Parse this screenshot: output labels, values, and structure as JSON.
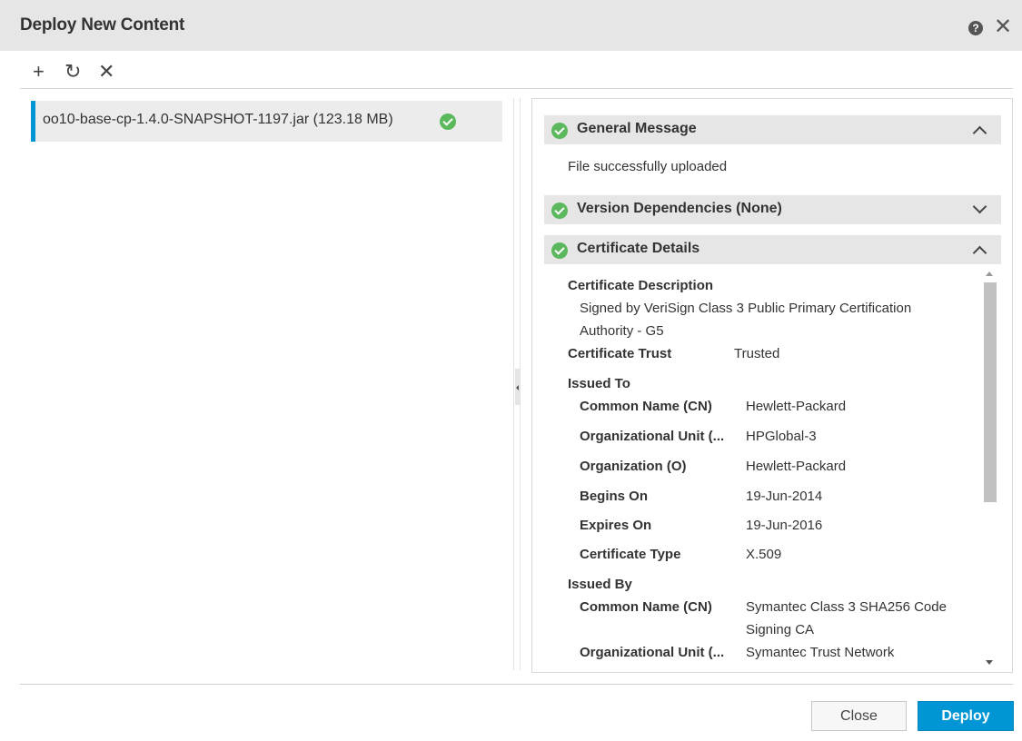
{
  "dialog": {
    "title": "Deploy New Content",
    "help_glyph": "?",
    "close_glyph": "✕"
  },
  "toolbar": {
    "add_glyph": "+",
    "refresh_glyph": "↻",
    "remove_glyph": "✕"
  },
  "files": [
    {
      "name": "oo10-base-cp-1.4.0-SNAPSHOT-1197.jar (123.18 MB)",
      "status": "success"
    }
  ],
  "sections": {
    "general": {
      "title": "General Message",
      "message": "File successfully uploaded",
      "expanded": true
    },
    "dependencies": {
      "title": "Version Dependencies (None)",
      "expanded": false
    },
    "certificate": {
      "title": "Certificate Details",
      "expanded": true,
      "description_label": "Certificate Description",
      "description_line1": "Signed by VeriSign Class 3 Public Primary Certification",
      "description_line2": "Authority - G5",
      "trust_label": "Certificate Trust",
      "trust_value": "Trusted",
      "issued_to": {
        "heading": "Issued To",
        "rows": [
          {
            "label": "Common Name (CN)",
            "value": "Hewlett-Packard"
          },
          {
            "label": "Organizational Unit (...",
            "value": "HPGlobal-3"
          },
          {
            "label": "Organization (O)",
            "value": "Hewlett-Packard"
          },
          {
            "label": "Begins On",
            "value": "19-Jun-2014"
          },
          {
            "label": "Expires On",
            "value": "19-Jun-2016"
          },
          {
            "label": "Certificate Type",
            "value": "X.509"
          }
        ]
      },
      "issued_by": {
        "heading": "Issued By",
        "cn_label": "Common Name (CN)",
        "cn_value_line1": "Symantec Class 3 SHA256 Code",
        "cn_value_line2": "Signing CA",
        "ou_label": "Organizational Unit (...",
        "ou_value": "Symantec Trust Network"
      }
    }
  },
  "footer": {
    "close_label": "Close",
    "deploy_label": "Deploy"
  },
  "colors": {
    "accent": "#0096d6",
    "success": "#5cb85c",
    "header_bg": "#e6e6e6"
  }
}
